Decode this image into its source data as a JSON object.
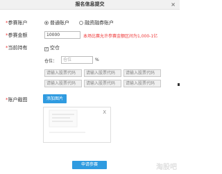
{
  "dialog": {
    "title": "报名信息提交",
    "close_glyph": "×"
  },
  "account_type": {
    "label": "参赛账户",
    "required_mark": "*",
    "options": [
      "普通账户",
      "融资融券账户"
    ],
    "selected": "普通账户"
  },
  "amount": {
    "label": "参赛金额",
    "required_mark": "*",
    "value": "10000",
    "hint": "本场比赛允许参赛金额区间为1,000-1亿"
  },
  "holdings": {
    "label": "当前持有",
    "required_mark": "*",
    "empty_position_label": "空仓",
    "position_label": "仓位：",
    "position_placeholder": "仓位",
    "percent_sign": "%",
    "stock_placeholder": "请输入股票代码"
  },
  "screenshot": {
    "label": "账户截图",
    "required_mark": "*",
    "add_button": "添加图片",
    "preview_close": "X"
  },
  "submit": {
    "label": "申请参赛"
  },
  "watermark": "淘股吧",
  "colors": {
    "accent_blue": "#2f9be0",
    "required_red": "#ee3333"
  }
}
